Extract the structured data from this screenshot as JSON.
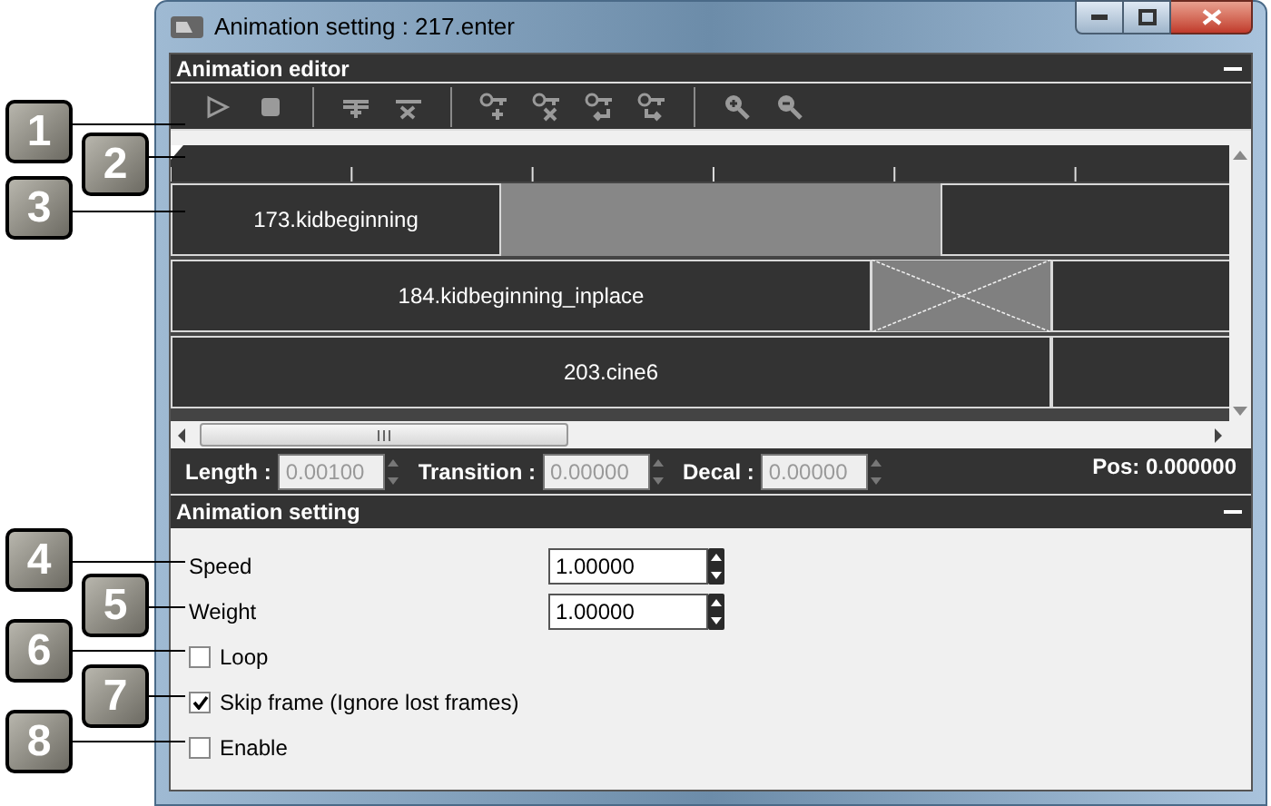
{
  "window": {
    "title": "Animation setting : 217.enter"
  },
  "callouts": [
    "1",
    "2",
    "3",
    "4",
    "5",
    "6",
    "7",
    "8"
  ],
  "editor": {
    "title": "Animation editor",
    "tracks": [
      {
        "segments": [
          {
            "kind": "clip",
            "label": "173.kidbeginning"
          },
          {
            "kind": "transition"
          },
          {
            "kind": "empty"
          }
        ]
      },
      {
        "segments": [
          {
            "kind": "clip",
            "label": "184.kidbeginning_inplace"
          },
          {
            "kind": "cross"
          },
          {
            "kind": "empty"
          }
        ]
      },
      {
        "segments": [
          {
            "kind": "clip",
            "label": "203.cine6"
          },
          {
            "kind": "empty"
          }
        ]
      }
    ],
    "fields": [
      {
        "label": "Length :",
        "value": "0.00100",
        "disabled": true
      },
      {
        "label": "Transition :",
        "value": "0.00000",
        "disabled": true
      },
      {
        "label": "Decal :",
        "value": "0.00000",
        "disabled": true
      }
    ],
    "pos": "Pos: 0.000000"
  },
  "settings": {
    "title": "Animation setting",
    "spinners": [
      {
        "label": "Speed",
        "value": "1.00000"
      },
      {
        "label": "Weight",
        "value": "1.00000"
      }
    ],
    "checkboxes": [
      {
        "label": "Loop",
        "checked": false
      },
      {
        "label": "Skip frame (Ignore lost frames)",
        "checked": true
      },
      {
        "label": "Enable",
        "checked": false
      }
    ]
  }
}
